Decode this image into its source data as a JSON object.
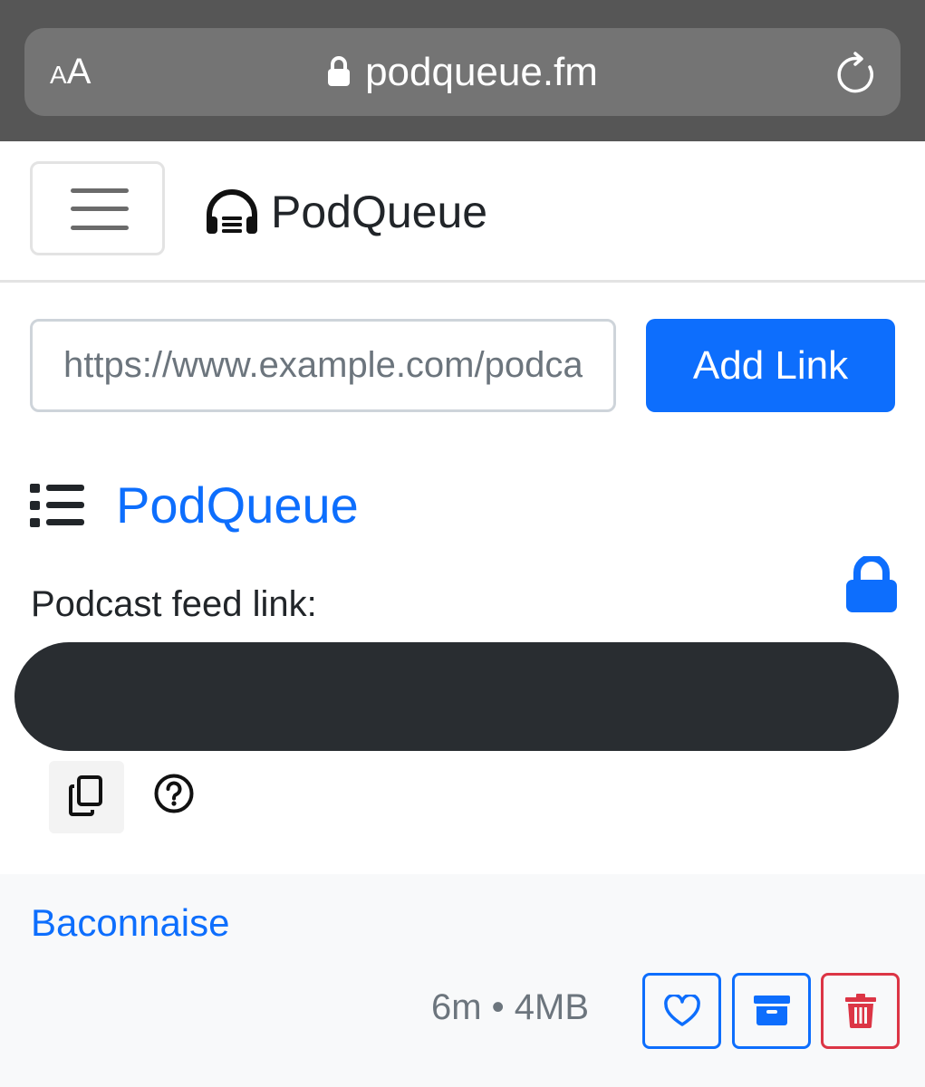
{
  "browser": {
    "text_size_button": {
      "small": "A",
      "large": "A"
    },
    "url": "podqueue.fm",
    "icons": {
      "lock": "lock-icon",
      "reload": "reload-icon"
    }
  },
  "navbar": {
    "menu_icon": "hamburger-icon",
    "brand": {
      "icon": "headphones-icon",
      "name": "PodQueue"
    }
  },
  "add_form": {
    "placeholder": "https://www.example.com/podcast",
    "button_label": "Add Link"
  },
  "queue": {
    "icon": "list-icon",
    "title": "PodQueue",
    "feed_label": "Podcast feed link:",
    "lock_icon": "lock-icon",
    "actions": {
      "copy_icon": "copy-icon",
      "help_icon": "question-circle-icon"
    }
  },
  "episodes": [
    {
      "title": "Baconnaise",
      "meta": "6m • 4MB",
      "actions": [
        "heart-icon",
        "archive-icon",
        "trash-icon"
      ]
    }
  ],
  "colors": {
    "primary": "#0d6efd",
    "danger": "#dc3545",
    "browser_chrome": "#565656",
    "muted": "#6c757d"
  }
}
